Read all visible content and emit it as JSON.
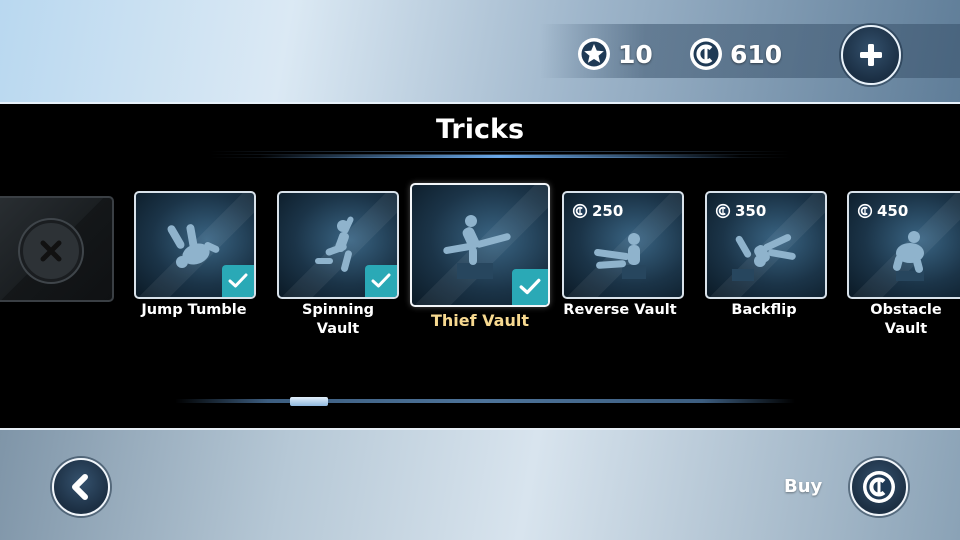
{
  "header": {
    "stars": "10",
    "coins": "610",
    "stars_icon": "star-coin-icon",
    "coins_icon": "c-coin-icon",
    "add_icon": "plus-icon"
  },
  "screen": {
    "title": "Tricks"
  },
  "tricks": [
    {
      "name": "Jump Tumble",
      "owned": true,
      "price": "",
      "selected": false
    },
    {
      "name": "Spinning\nVault",
      "owned": true,
      "price": "",
      "selected": false
    },
    {
      "name": "Thief Vault",
      "owned": true,
      "price": "",
      "selected": true
    },
    {
      "name": "Reverse Vault",
      "owned": false,
      "price": "250",
      "selected": false
    },
    {
      "name": "Backflip",
      "owned": false,
      "price": "350",
      "selected": false
    },
    {
      "name": "Obstacle\nVault",
      "owned": false,
      "price": "450",
      "selected": false
    }
  ],
  "labels": {
    "t0": "Jump Tumble",
    "t1a": "Spinning",
    "t1b": "Vault",
    "t2": "Thief Vault",
    "t3": "Reverse Vault",
    "t4": "Backflip",
    "t5a": "Obstacle",
    "t5b": "Vault",
    "p3": "250",
    "p4": "350",
    "p5": "450"
  },
  "footer": {
    "buy_label": "Buy",
    "back_icon": "chevron-left-icon",
    "buy_icon": "c-coin-icon"
  },
  "colors": {
    "accent_check": "#2aa9b6",
    "selected_label": "#f7d990"
  }
}
